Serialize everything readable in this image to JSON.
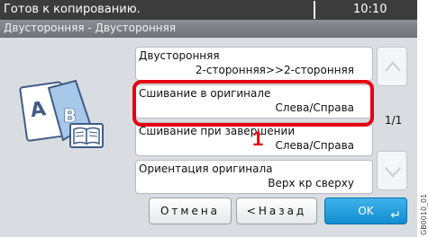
{
  "status": {
    "message": "Готов к копированию.",
    "time": "10:10"
  },
  "breadcrumb": "Двусторонняя - Двусторонняя",
  "options": [
    {
      "title": "Двусторонняя",
      "value": "2-сторонняя>>2-сторонняя"
    },
    {
      "title": "Сшивание в оригинале",
      "value": "Слева/Справа"
    },
    {
      "title": "Сшивание при завершении",
      "value": "Слева/Справа"
    },
    {
      "title": "Ориентация оригинала",
      "value": "Верх кр сверху"
    }
  ],
  "page_indicator": "1/1",
  "callout": "1",
  "buttons": {
    "cancel": "Отмена",
    "back": "<Назад",
    "ok": "OK"
  },
  "side_code": "GB0010_01",
  "colors": {
    "highlight": "#e60012",
    "ok_button": "#1a9ad8",
    "status_bar": "#3c3c3c"
  },
  "icons": {
    "illustration": "duplex-document-book-icon",
    "scroll_up": "chevron-up-icon",
    "scroll_down": "chevron-down-icon",
    "enter": "enter-icon"
  }
}
